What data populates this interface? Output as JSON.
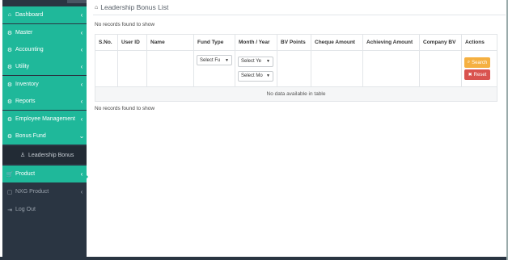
{
  "sidebar": {
    "items": [
      {
        "label": "Dashboard",
        "icon": "home-icon"
      },
      {
        "label": "Master",
        "icon": "gear-icon"
      },
      {
        "label": "Accounting",
        "icon": "gear-icon"
      },
      {
        "label": "Utility",
        "icon": "gear-icon"
      },
      {
        "label": "Inventory",
        "icon": "gear-icon"
      },
      {
        "label": "Reports",
        "icon": "gear-icon"
      },
      {
        "label": "Employee Management",
        "icon": "gear-icon"
      },
      {
        "label": "Bonus Fund",
        "icon": "gear-icon"
      }
    ],
    "sub_item": {
      "label": "Leadership Bonus",
      "icon": "user-icon"
    },
    "product": {
      "label": "Product",
      "icon": "cart-icon"
    },
    "nxg": {
      "label": "NXG Product",
      "icon": "box-icon"
    },
    "logout": {
      "label": "Log Out",
      "icon": "logout-icon"
    }
  },
  "page": {
    "title": "Leadership Bonus List",
    "info_top": "No records found to show",
    "info_bottom": "No records found to show"
  },
  "table": {
    "headers": [
      "S.No.",
      "User ID",
      "Name",
      "Fund Type",
      "Month / Year",
      "BV Points",
      "Cheque Amount",
      "Achieving Amount",
      "Company BV",
      "Actions"
    ],
    "fund_type_select": "Select Fu",
    "year_select": "Select Ye",
    "month_select": "Select Mo",
    "search_label": "Search",
    "reset_label": "Reset",
    "empty_text": "No data available in table"
  },
  "colors": {
    "accent": "#1fb89a",
    "sidebar": "#2a3542",
    "search": "#f5b041",
    "reset": "#d9534f"
  }
}
